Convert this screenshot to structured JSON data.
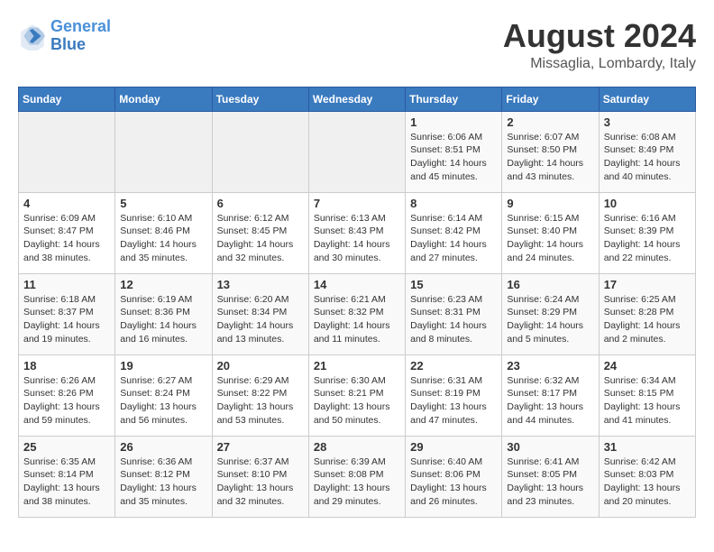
{
  "logo": {
    "line1": "General",
    "line2": "Blue"
  },
  "title": "August 2024",
  "subtitle": "Missaglia, Lombardy, Italy",
  "days_of_week": [
    "Sunday",
    "Monday",
    "Tuesday",
    "Wednesday",
    "Thursday",
    "Friday",
    "Saturday"
  ],
  "weeks": [
    [
      {
        "day": "",
        "info": ""
      },
      {
        "day": "",
        "info": ""
      },
      {
        "day": "",
        "info": ""
      },
      {
        "day": "",
        "info": ""
      },
      {
        "day": "1",
        "info": "Sunrise: 6:06 AM\nSunset: 8:51 PM\nDaylight: 14 hours and 45 minutes."
      },
      {
        "day": "2",
        "info": "Sunrise: 6:07 AM\nSunset: 8:50 PM\nDaylight: 14 hours and 43 minutes."
      },
      {
        "day": "3",
        "info": "Sunrise: 6:08 AM\nSunset: 8:49 PM\nDaylight: 14 hours and 40 minutes."
      }
    ],
    [
      {
        "day": "4",
        "info": "Sunrise: 6:09 AM\nSunset: 8:47 PM\nDaylight: 14 hours and 38 minutes."
      },
      {
        "day": "5",
        "info": "Sunrise: 6:10 AM\nSunset: 8:46 PM\nDaylight: 14 hours and 35 minutes."
      },
      {
        "day": "6",
        "info": "Sunrise: 6:12 AM\nSunset: 8:45 PM\nDaylight: 14 hours and 32 minutes."
      },
      {
        "day": "7",
        "info": "Sunrise: 6:13 AM\nSunset: 8:43 PM\nDaylight: 14 hours and 30 minutes."
      },
      {
        "day": "8",
        "info": "Sunrise: 6:14 AM\nSunset: 8:42 PM\nDaylight: 14 hours and 27 minutes."
      },
      {
        "day": "9",
        "info": "Sunrise: 6:15 AM\nSunset: 8:40 PM\nDaylight: 14 hours and 24 minutes."
      },
      {
        "day": "10",
        "info": "Sunrise: 6:16 AM\nSunset: 8:39 PM\nDaylight: 14 hours and 22 minutes."
      }
    ],
    [
      {
        "day": "11",
        "info": "Sunrise: 6:18 AM\nSunset: 8:37 PM\nDaylight: 14 hours and 19 minutes."
      },
      {
        "day": "12",
        "info": "Sunrise: 6:19 AM\nSunset: 8:36 PM\nDaylight: 14 hours and 16 minutes."
      },
      {
        "day": "13",
        "info": "Sunrise: 6:20 AM\nSunset: 8:34 PM\nDaylight: 14 hours and 13 minutes."
      },
      {
        "day": "14",
        "info": "Sunrise: 6:21 AM\nSunset: 8:32 PM\nDaylight: 14 hours and 11 minutes."
      },
      {
        "day": "15",
        "info": "Sunrise: 6:23 AM\nSunset: 8:31 PM\nDaylight: 14 hours and 8 minutes."
      },
      {
        "day": "16",
        "info": "Sunrise: 6:24 AM\nSunset: 8:29 PM\nDaylight: 14 hours and 5 minutes."
      },
      {
        "day": "17",
        "info": "Sunrise: 6:25 AM\nSunset: 8:28 PM\nDaylight: 14 hours and 2 minutes."
      }
    ],
    [
      {
        "day": "18",
        "info": "Sunrise: 6:26 AM\nSunset: 8:26 PM\nDaylight: 13 hours and 59 minutes."
      },
      {
        "day": "19",
        "info": "Sunrise: 6:27 AM\nSunset: 8:24 PM\nDaylight: 13 hours and 56 minutes."
      },
      {
        "day": "20",
        "info": "Sunrise: 6:29 AM\nSunset: 8:22 PM\nDaylight: 13 hours and 53 minutes."
      },
      {
        "day": "21",
        "info": "Sunrise: 6:30 AM\nSunset: 8:21 PM\nDaylight: 13 hours and 50 minutes."
      },
      {
        "day": "22",
        "info": "Sunrise: 6:31 AM\nSunset: 8:19 PM\nDaylight: 13 hours and 47 minutes."
      },
      {
        "day": "23",
        "info": "Sunrise: 6:32 AM\nSunset: 8:17 PM\nDaylight: 13 hours and 44 minutes."
      },
      {
        "day": "24",
        "info": "Sunrise: 6:34 AM\nSunset: 8:15 PM\nDaylight: 13 hours and 41 minutes."
      }
    ],
    [
      {
        "day": "25",
        "info": "Sunrise: 6:35 AM\nSunset: 8:14 PM\nDaylight: 13 hours and 38 minutes."
      },
      {
        "day": "26",
        "info": "Sunrise: 6:36 AM\nSunset: 8:12 PM\nDaylight: 13 hours and 35 minutes."
      },
      {
        "day": "27",
        "info": "Sunrise: 6:37 AM\nSunset: 8:10 PM\nDaylight: 13 hours and 32 minutes."
      },
      {
        "day": "28",
        "info": "Sunrise: 6:39 AM\nSunset: 8:08 PM\nDaylight: 13 hours and 29 minutes."
      },
      {
        "day": "29",
        "info": "Sunrise: 6:40 AM\nSunset: 8:06 PM\nDaylight: 13 hours and 26 minutes."
      },
      {
        "day": "30",
        "info": "Sunrise: 6:41 AM\nSunset: 8:05 PM\nDaylight: 13 hours and 23 minutes."
      },
      {
        "day": "31",
        "info": "Sunrise: 6:42 AM\nSunset: 8:03 PM\nDaylight: 13 hours and 20 minutes."
      }
    ]
  ]
}
